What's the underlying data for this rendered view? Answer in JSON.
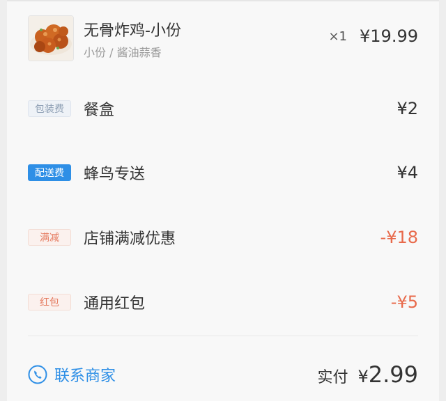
{
  "item": {
    "name": "无骨炸鸡-小份",
    "spec": "小份 / 酱油蒜香",
    "qty": "×1",
    "price": "¥19.99"
  },
  "fees": [
    {
      "tag": "包装费",
      "title": "餐盒",
      "amount": "¥2"
    },
    {
      "tag": "配送费",
      "title": "蜂鸟专送",
      "amount": "¥4"
    },
    {
      "tag": "满减",
      "title": "店铺满减优惠",
      "amount": "-¥18"
    },
    {
      "tag": "红包",
      "title": "通用红包",
      "amount": "-¥5"
    }
  ],
  "footer": {
    "contact_label": "联系商家",
    "total_label": "实付",
    "total_currency": "¥",
    "total_value": "2.99"
  },
  "colors": {
    "accent_blue": "#2e8fe6",
    "discount_red": "#e8694a",
    "text_main": "#333333",
    "text_sub": "#9a9a9a"
  },
  "icons": {
    "item_image": "fried-chicken-thumbnail",
    "contact_icon": "phone-icon"
  }
}
